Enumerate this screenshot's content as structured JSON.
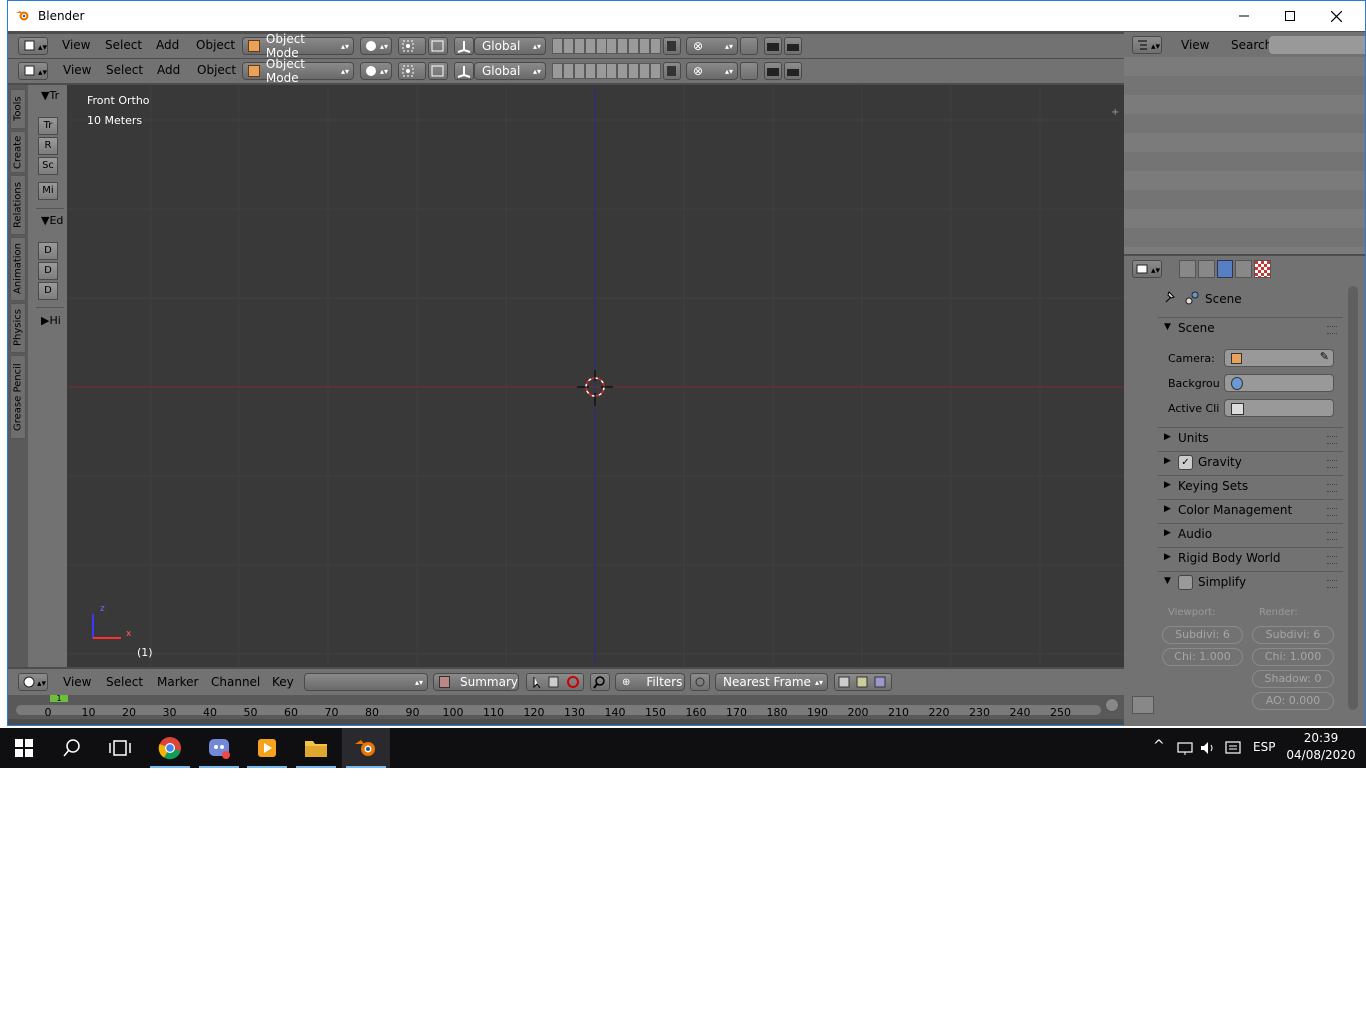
{
  "window": {
    "title": "Blender"
  },
  "window_buttons": {
    "minimize": "—",
    "maximize": "☐",
    "close": "✕"
  },
  "view3d_header": {
    "menus": [
      "View",
      "Select",
      "Add",
      "Object"
    ],
    "mode": "Object Mode",
    "orientation": "Global"
  },
  "tool_tabs": [
    "Tools",
    "Create",
    "Relations",
    "Animation",
    "Physics",
    "Grease Pencil"
  ],
  "tool_shelf": {
    "transform_header": "Tr",
    "transform_buttons": [
      "Tr",
      "R",
      "Sc"
    ],
    "mirror_button": "Mi",
    "edit_header": "Ed",
    "edit_buttons": [
      "D",
      "D",
      "D"
    ],
    "history_header": "Hi"
  },
  "viewport": {
    "view_name": "Front Ortho",
    "scale": "10 Meters",
    "frame": "(1)",
    "axis_z": "z",
    "axis_x": "x"
  },
  "timeline_header": {
    "menus": [
      "View",
      "Select",
      "Marker",
      "Channel",
      "Key"
    ],
    "summary": "Summary",
    "filters": "Filters",
    "snap": "Nearest Frame"
  },
  "timeline": {
    "current_frame": "1",
    "ticks": [
      "0",
      "10",
      "20",
      "30",
      "40",
      "50",
      "60",
      "70",
      "80",
      "90",
      "100",
      "110",
      "120",
      "130",
      "140",
      "150",
      "160",
      "170",
      "180",
      "190",
      "200",
      "210",
      "220",
      "230",
      "240",
      "250"
    ]
  },
  "outliner_header": {
    "menus": [
      "View",
      "Search"
    ]
  },
  "properties": {
    "context": "Scene",
    "scene_panel": {
      "title": "Scene",
      "fields": [
        {
          "label": "Camera:"
        },
        {
          "label": "Backgrou"
        },
        {
          "label": "Active Cli"
        }
      ]
    },
    "collapsed_panels": [
      "Units",
      "Gravity",
      "Keying Sets",
      "Color Management",
      "Audio",
      "Rigid Body World"
    ],
    "simplify": {
      "title": "Simplify",
      "viewport_label": "Viewport:",
      "render_label": "Render:",
      "viewport_subdiv": "Subdivi: 6",
      "viewport_child": "Chi: 1.000",
      "render_subdiv": "Subdivi: 6",
      "render_child": "Chi: 1.000",
      "render_shadow": "Shadow: 0",
      "render_ao": "AO: 0.000"
    }
  },
  "taskbar": {
    "tray_lang": "ESP",
    "time": "20:39",
    "date": "04/08/2020"
  }
}
